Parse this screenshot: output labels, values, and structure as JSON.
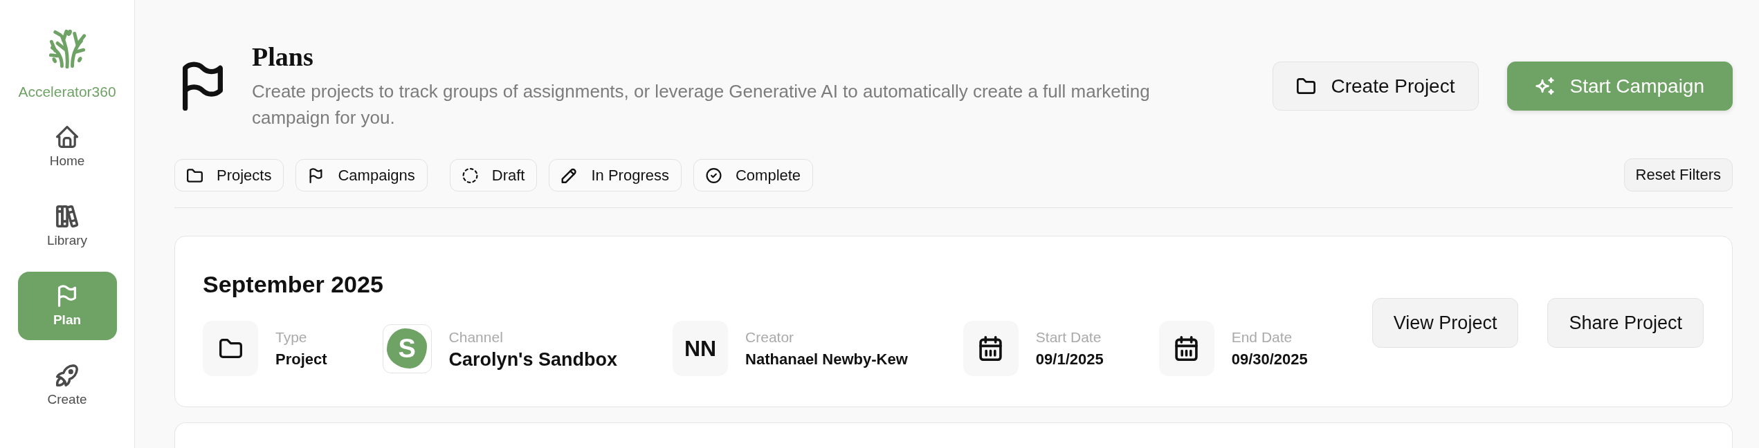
{
  "sidebar": {
    "logo_text": "Accelerator360",
    "items": [
      {
        "label": "Home",
        "selected": false
      },
      {
        "label": "Library",
        "selected": false
      },
      {
        "label": "Plan",
        "selected": true
      },
      {
        "label": "Create",
        "selected": false
      }
    ]
  },
  "header": {
    "title": "Plans",
    "description": "Create projects to track groups of assignments, or leverage Generative AI to automatically create a full marketing campaign for you.",
    "buttons": [
      {
        "label": "Create Project",
        "kind": "secondary"
      },
      {
        "label": "Start Campaign",
        "kind": "primary"
      }
    ]
  },
  "filters": {
    "groups": [
      {
        "items": [
          {
            "label": "Projects",
            "selected": false
          },
          {
            "label": "Campaigns",
            "selected": false
          }
        ]
      },
      {
        "items": [
          {
            "label": "Draft",
            "selected": false
          },
          {
            "label": "In Progress",
            "selected": false
          },
          {
            "label": "Complete",
            "selected": false
          }
        ]
      }
    ],
    "reset_button": {
      "label": "Reset Filters"
    }
  },
  "projects": [
    {
      "title": "September 2025",
      "details": [
        {
          "kind": "icon",
          "label": "Type",
          "value": "Project"
        },
        {
          "kind": "avatar",
          "label": "Channel",
          "value": "Carolyn's Sandbox",
          "avatar_letter": "S"
        },
        {
          "kind": "initials",
          "label": "Creator",
          "value": "Nathanael Newby-Kew",
          "initials": "NN"
        },
        {
          "kind": "date",
          "label": "Start Date",
          "value": "09/1/2025"
        },
        {
          "kind": "date",
          "label": "End Date",
          "value": "09/30/2025"
        }
      ],
      "actions": [
        {
          "label": "View Project"
        },
        {
          "label": "Share Project"
        }
      ]
    }
  ]
}
